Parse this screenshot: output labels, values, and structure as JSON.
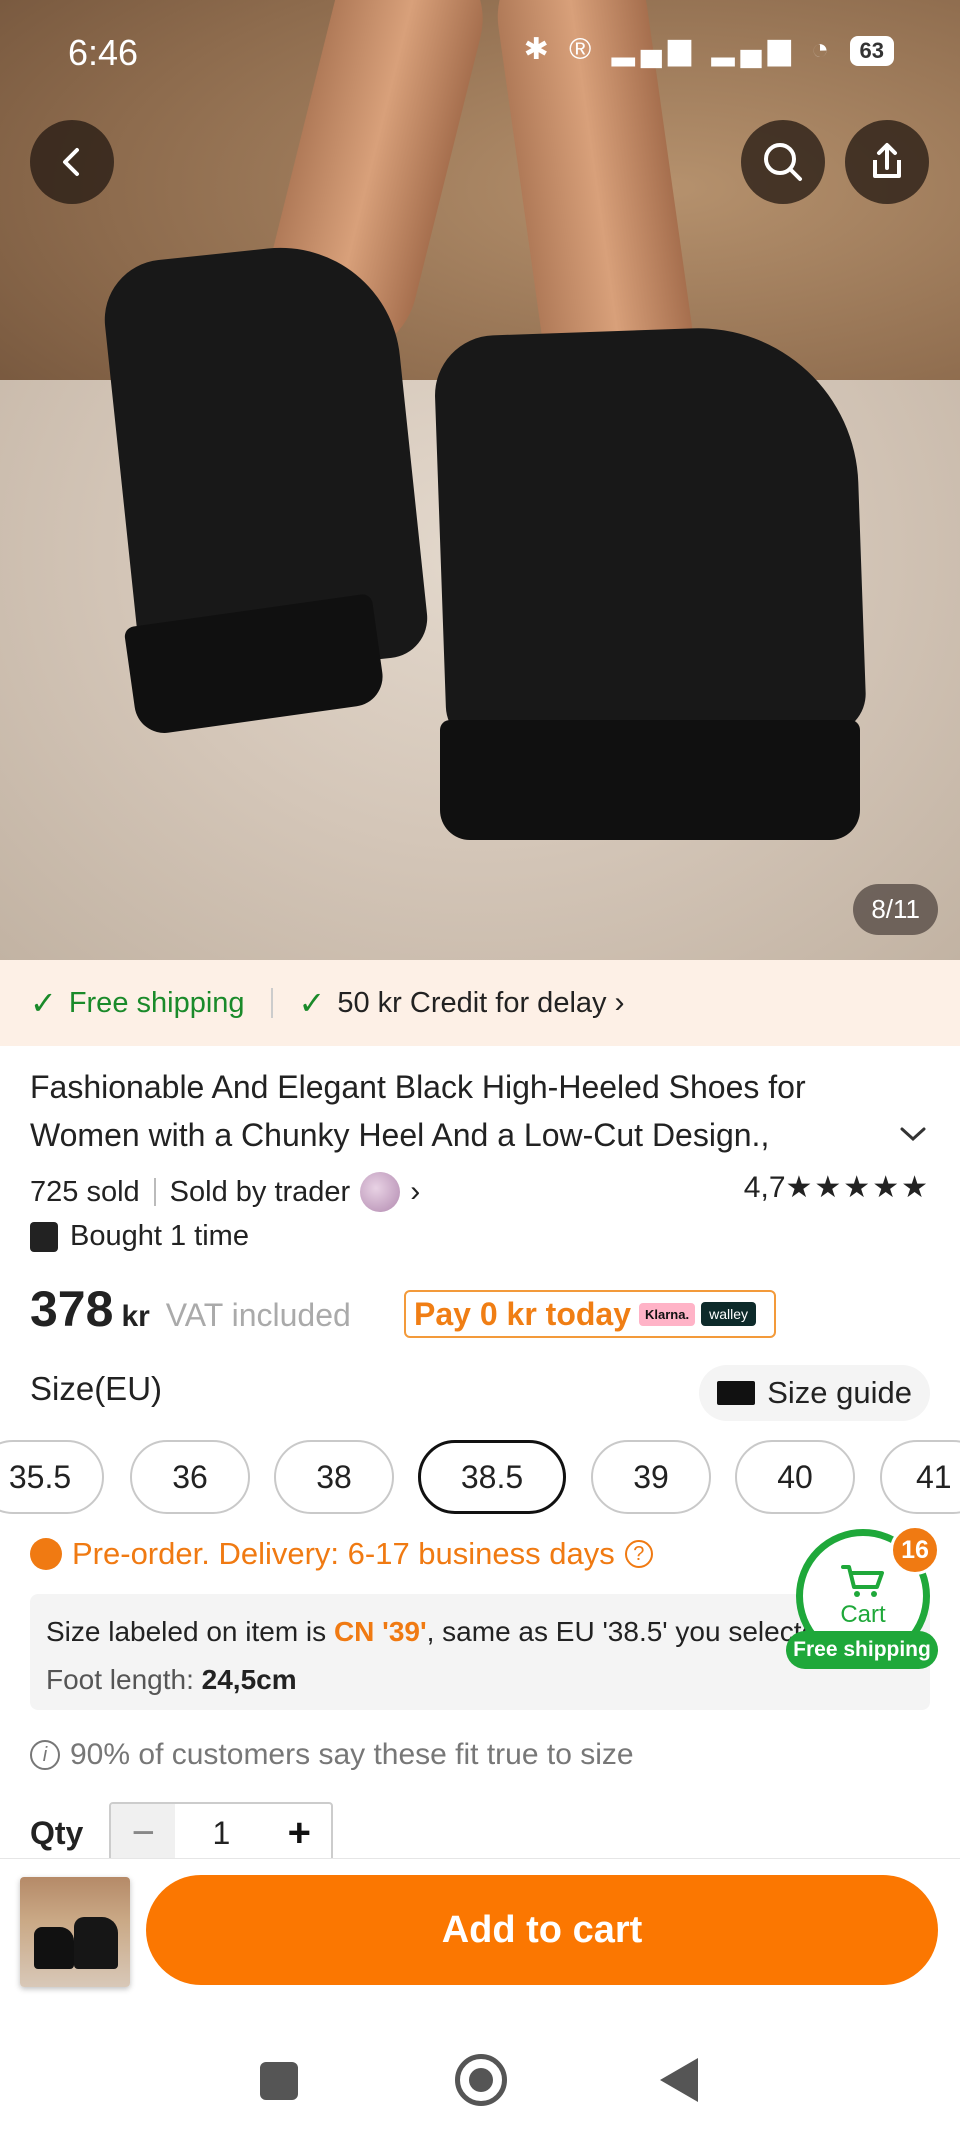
{
  "status_bar": {
    "time": "6:46",
    "icons": "✱ ® ▂▄▆ ▂▄▆ ◔",
    "battery": "63"
  },
  "gallery": {
    "counter": "8/11",
    "image_description_icons": [
      "back-icon",
      "search-icon",
      "share-icon"
    ]
  },
  "shipping_bar": {
    "free_shipping": "Free shipping",
    "credit": "50 kr Credit for delay",
    "chevron": "›"
  },
  "product": {
    "title": "Fashionable And Elegant Black High-Heeled Shoes for Women with a Chunky Heel And a Low-Cut Design.,",
    "sold": "725 sold",
    "seller": "Sold by trader",
    "rating_value": "4,7",
    "rating_stars": "★★★★★",
    "bought": "Bought 1 time",
    "price": "378",
    "currency": "kr",
    "vat": "VAT included",
    "pay_today": "Pay 0 kr today",
    "klarna": "Klarna.",
    "walley": "walley"
  },
  "size": {
    "label": "Size(EU)",
    "guide": "Size guide",
    "options": [
      "35.5",
      "36",
      "38",
      "38.5",
      "39",
      "40",
      "41"
    ],
    "selected": "38.5"
  },
  "preorder": {
    "text": "Pre-order. Delivery: 6-17 business days",
    "help": "?"
  },
  "size_info": {
    "prefix": "Size labeled on item is ",
    "cn": "CN '39'",
    "suffix": ", same as EU '38.5' you selected",
    "foot_label": "Foot length: ",
    "foot_value": "24,5cm"
  },
  "fit": {
    "icon": "i",
    "text": "90% of customers say these fit true to size"
  },
  "quantity": {
    "label": "Qty",
    "minus": "−",
    "value": "1",
    "plus": "+"
  },
  "cart_widget": {
    "label": "Cart",
    "count": "16",
    "shipping": "Free shipping"
  },
  "bottom": {
    "add_to_cart": "Add to cart"
  },
  "colors": {
    "accent": "#fb7701",
    "green": "#1fa83a",
    "orange_text": "#f07a12"
  }
}
